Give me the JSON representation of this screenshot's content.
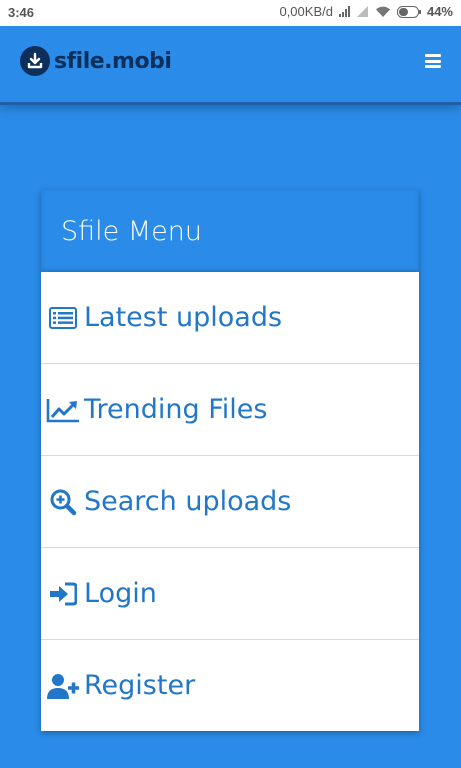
{
  "status_bar": {
    "time": "3:46",
    "network_speed": "0,00KB/d",
    "battery": "44%",
    "icons": [
      "signal-icon",
      "signal-weak-icon",
      "wifi-icon",
      "battery-icon"
    ]
  },
  "header": {
    "logo_text": "sfile.mobi",
    "logo_icon": "download-icon",
    "menu_icon": "hamburger-icon"
  },
  "menu": {
    "title": "Sfile Menu",
    "items": [
      {
        "label": "Latest uploads",
        "icon": "list-icon"
      },
      {
        "label": "Trending Files",
        "icon": "trending-chart-icon"
      },
      {
        "label": "Search uploads",
        "icon": "search-plus-icon"
      },
      {
        "label": "Login",
        "icon": "sign-in-icon"
      },
      {
        "label": "Register",
        "icon": "add-user-icon"
      }
    ]
  },
  "colors": {
    "primary": "#2a8be8",
    "link": "#2277c8",
    "logo_dark": "#0d2f5c",
    "card_bg": "#ffffff"
  }
}
